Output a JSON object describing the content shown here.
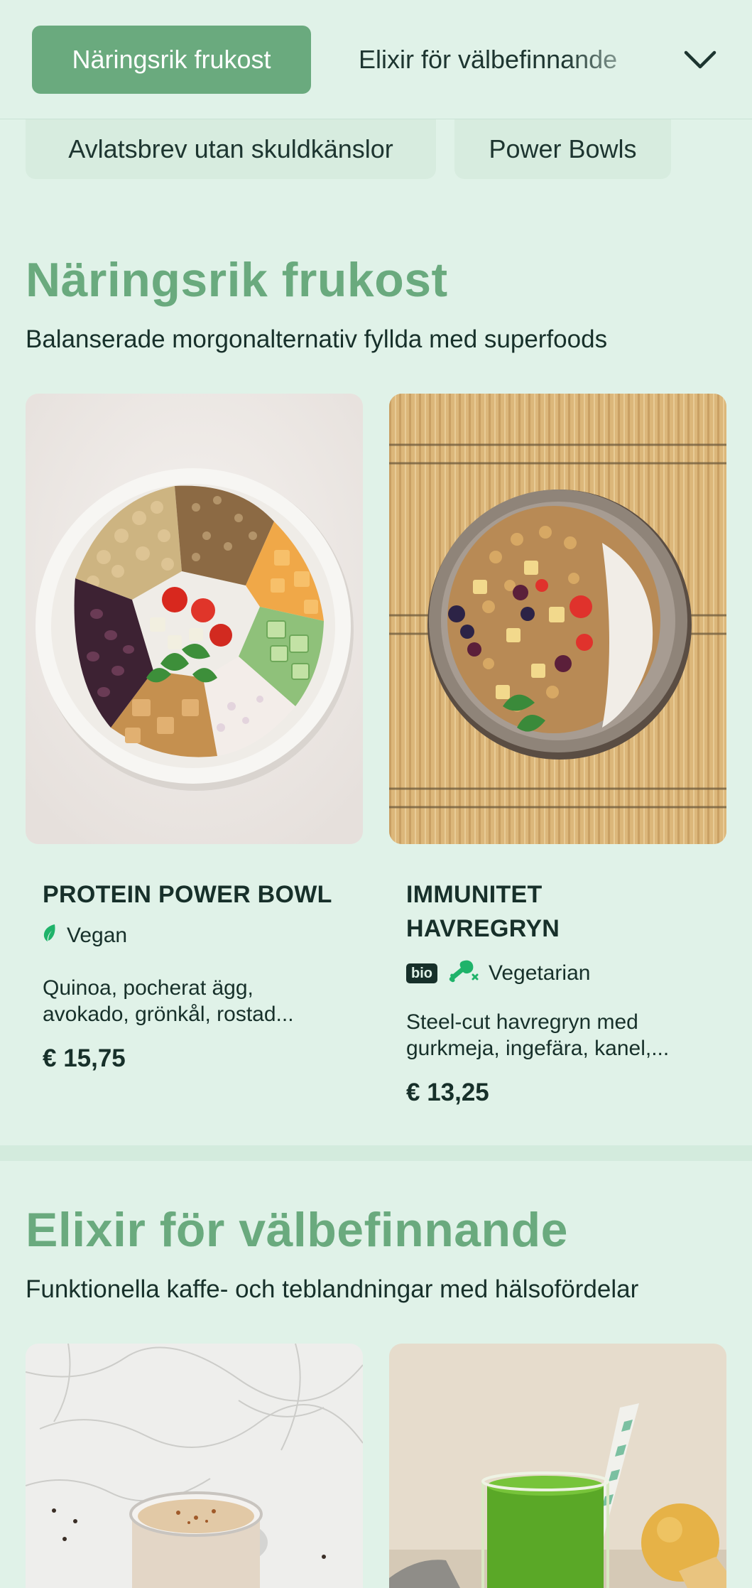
{
  "nav": {
    "tabs": [
      {
        "label": "Näringsrik frukost",
        "active": true
      },
      {
        "label": "Elixir för välbefinnande",
        "active": false
      },
      {
        "label": "Avlatsbrev utan skuldkänslor",
        "active": false
      },
      {
        "label": "Power Bowls",
        "active": false
      }
    ],
    "expand_icon": "chevron-down-icon"
  },
  "sections": [
    {
      "title": "Näringsrik frukost",
      "subtitle": "Balanserade morgonalternativ fyllda med superfoods",
      "products": [
        {
          "name": "PROTEIN POWER BOWL",
          "badges": [],
          "diet": "Vegan",
          "diet_icon": "leaf-icon",
          "description_line1": "Quinoa, pocherat ägg,",
          "description_line2": "avokado, grönkål, rostad...",
          "price": "€ 15,75"
        },
        {
          "name_line1": "IMMUNITET",
          "name_line2": "HAVREGRYN",
          "badges": [
            "bio"
          ],
          "diet": "Vegetarian",
          "diet_icon": "drumstick-crossed-icon",
          "description_line1": "Steel-cut havregryn med",
          "description_line2": "gurkmeja, ingefära, kanel,...",
          "price": "€ 13,25"
        }
      ]
    },
    {
      "title": "Elixir för välbefinnande",
      "subtitle": "Funktionella kaffe- och teblandningar med hälsofördelar",
      "products": [
        {
          "image": "spiced-latte-on-marble"
        },
        {
          "image": "green-juice-with-straw"
        }
      ]
    }
  ],
  "colors": {
    "background": "#e0f2e8",
    "accent": "#6aaa7e",
    "text": "#17302a",
    "diet_icon": "#1fb36a"
  }
}
